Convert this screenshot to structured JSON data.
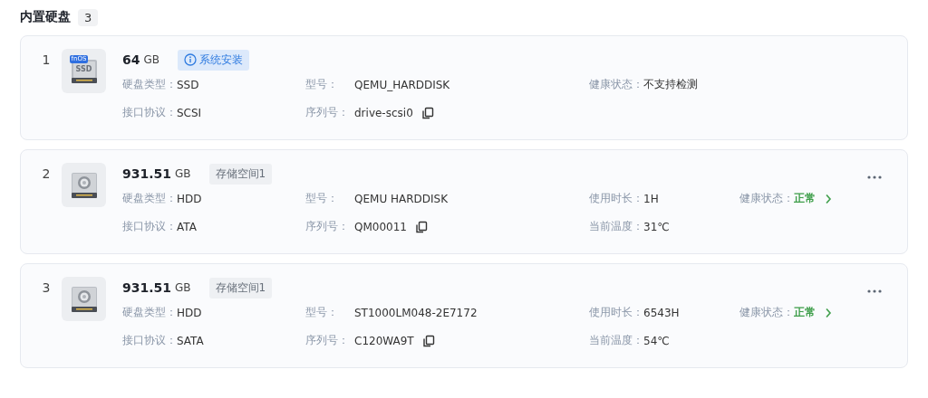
{
  "section": {
    "title": "内置硬盘",
    "count": "3"
  },
  "disks": [
    {
      "index": "1",
      "drive": {
        "kind": "ssd",
        "badge": "fnOS",
        "label": "SSD"
      },
      "size": "64",
      "unit": "GB",
      "tag": {
        "kind": "info",
        "text": "系统安装"
      },
      "menu": false,
      "rows": [
        [
          {
            "kind": "text",
            "label": "硬盘类型：",
            "value": "SSD"
          },
          {
            "kind": "text",
            "label": "型号：",
            "value": "QEMU_HARDDISK"
          },
          {
            "kind": "text",
            "label": "健康状态：",
            "value": "不支持检测"
          }
        ],
        [
          {
            "kind": "text",
            "label": "接口协议：",
            "value": "SCSI"
          },
          {
            "kind": "serial",
            "label": "序列号：",
            "value": "drive-scsi0"
          }
        ]
      ]
    },
    {
      "index": "2",
      "drive": {
        "kind": "hdd"
      },
      "size": "931.51",
      "unit": "GB",
      "tag": {
        "kind": "plain",
        "text": "存储空间1"
      },
      "menu": true,
      "rows": [
        [
          {
            "kind": "text",
            "label": "硬盘类型：",
            "value": "HDD"
          },
          {
            "kind": "text",
            "label": "型号：",
            "value": "QEMU HARDDISK"
          },
          {
            "kind": "text",
            "label": "使用时长：",
            "value": "1H"
          },
          {
            "kind": "health",
            "label": "健康状态：",
            "value": "正常"
          }
        ],
        [
          {
            "kind": "text",
            "label": "接口协议：",
            "value": "ATA"
          },
          {
            "kind": "serial",
            "label": "序列号：",
            "value": "QM00011"
          },
          {
            "kind": "text",
            "label": "当前温度：",
            "value": "31℃"
          }
        ]
      ]
    },
    {
      "index": "3",
      "drive": {
        "kind": "hdd"
      },
      "size": "931.51",
      "unit": "GB",
      "tag": {
        "kind": "plain",
        "text": "存储空间1"
      },
      "menu": true,
      "rows": [
        [
          {
            "kind": "text",
            "label": "硬盘类型：",
            "value": "HDD"
          },
          {
            "kind": "text",
            "label": "型号：",
            "value": "ST1000LM048-2E7172"
          },
          {
            "kind": "text",
            "label": "使用时长：",
            "value": "6543H"
          },
          {
            "kind": "health",
            "label": "健康状态：",
            "value": "正常"
          }
        ],
        [
          {
            "kind": "text",
            "label": "接口协议：",
            "value": "SATA"
          },
          {
            "kind": "serial",
            "label": "序列号：",
            "value": "C120WA9T"
          },
          {
            "kind": "text",
            "label": "当前温度：",
            "value": "54℃"
          }
        ]
      ]
    }
  ]
}
